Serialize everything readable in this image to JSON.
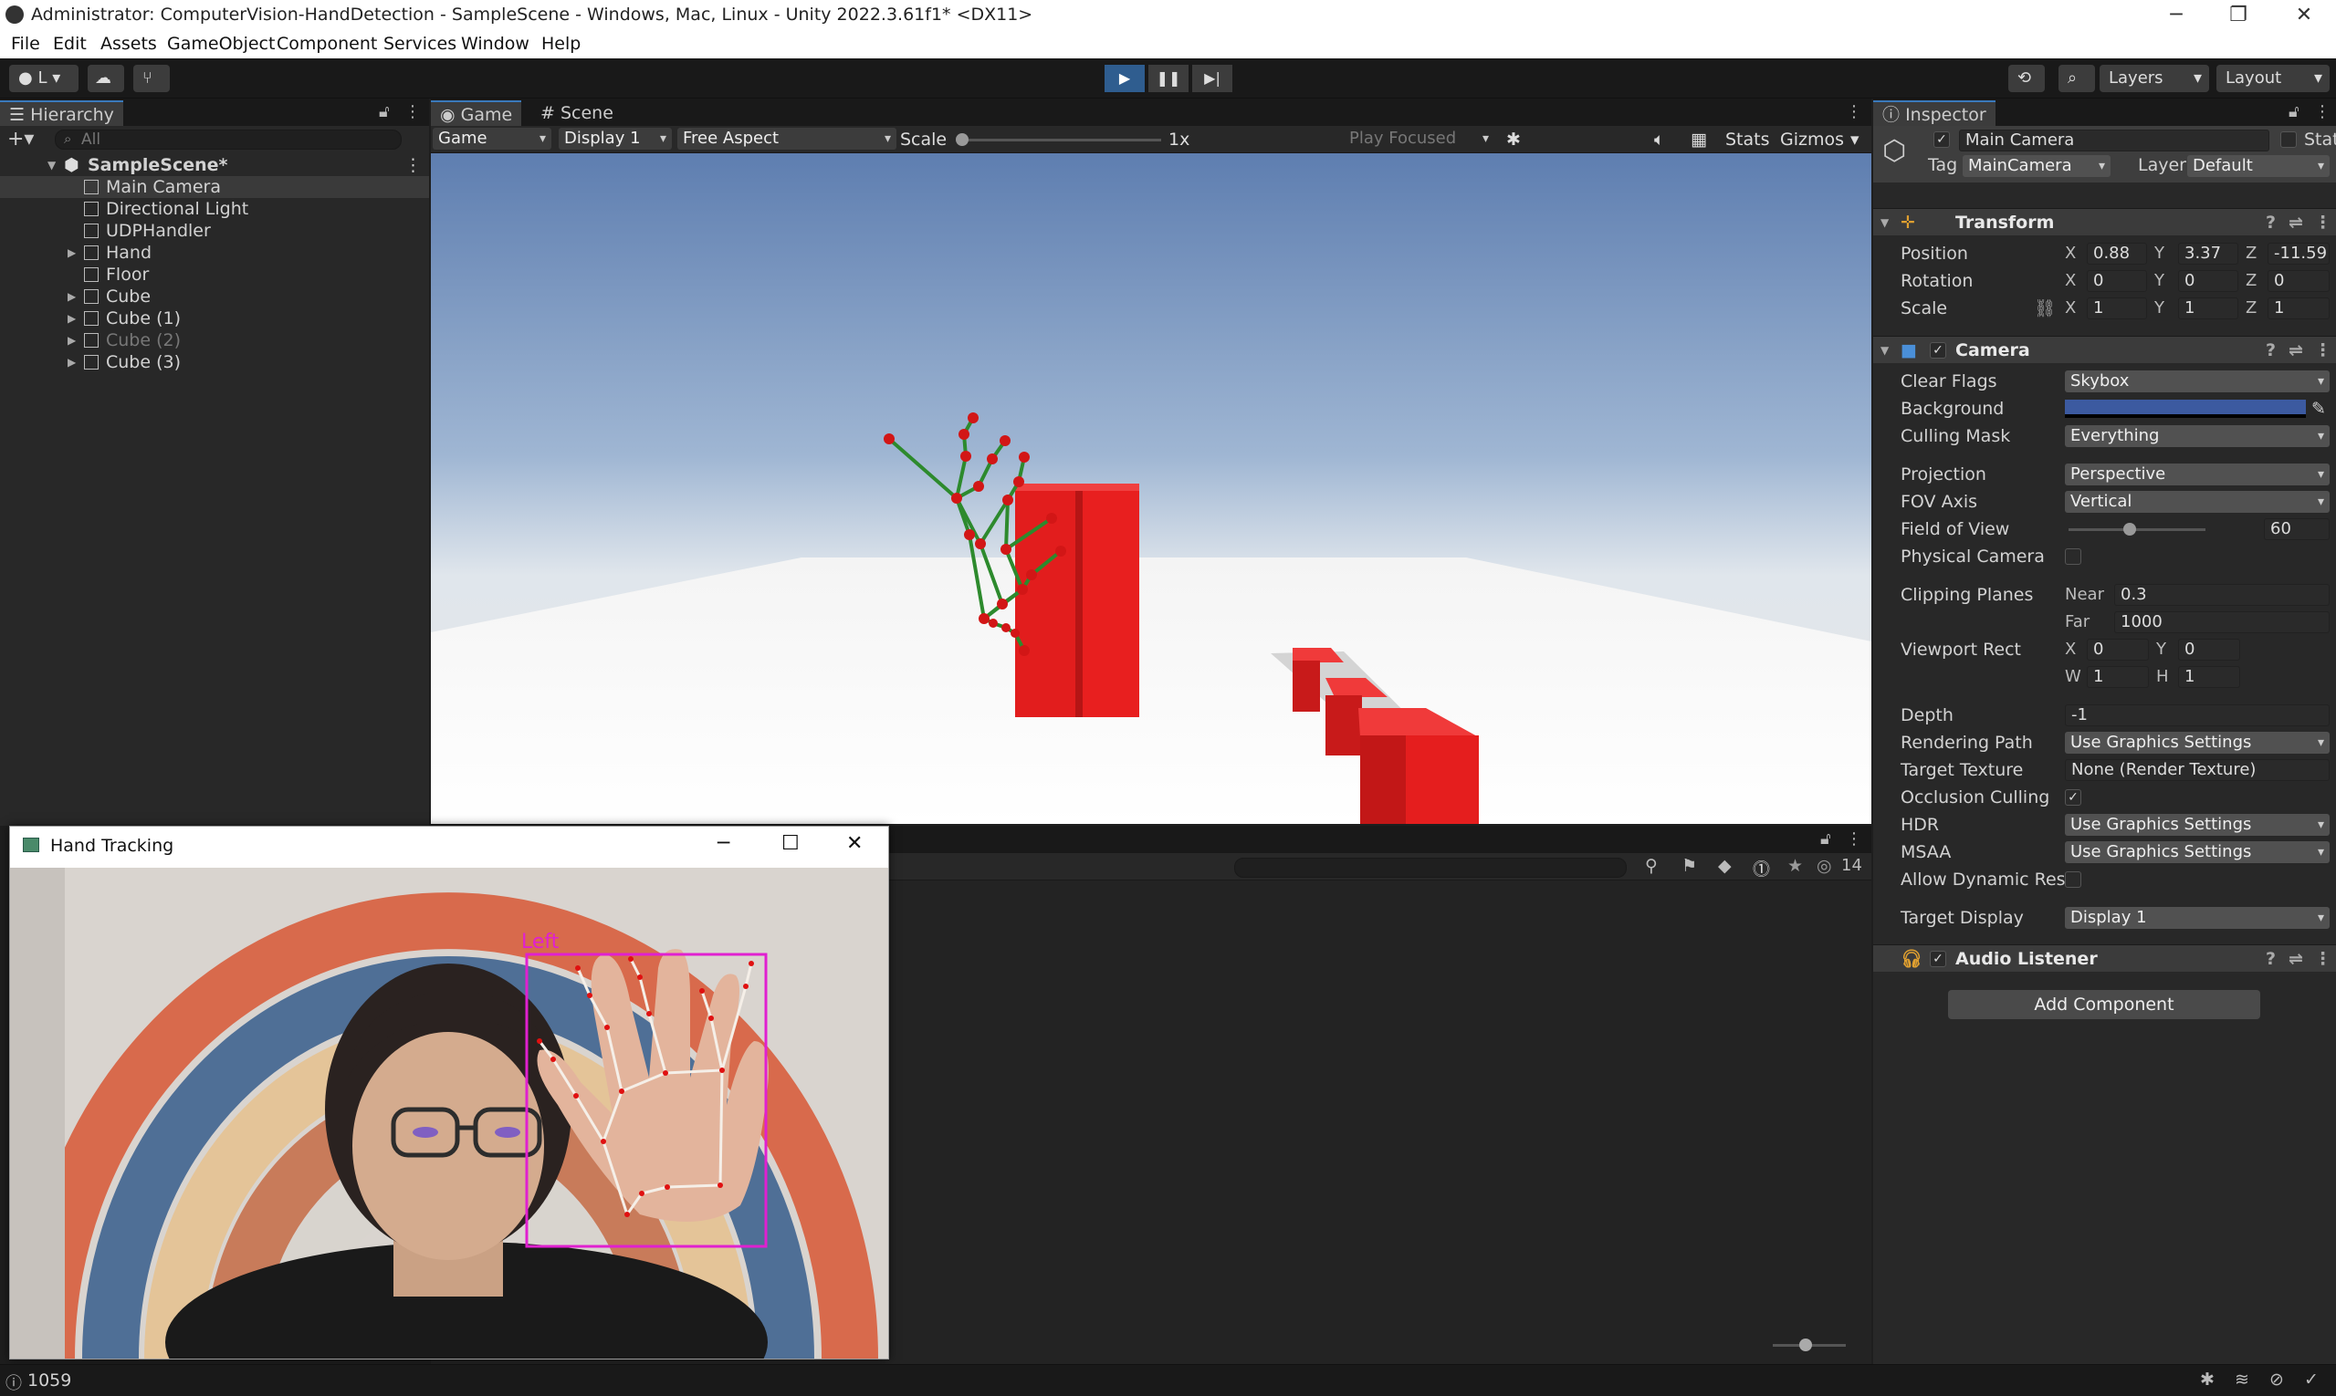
{
  "window": {
    "title": "Administrator: ComputerVision-HandDetection - SampleScene - Windows, Mac, Linux - Unity 2022.3.61f1* <DX11>"
  },
  "menu": [
    "File",
    "Edit",
    "Assets",
    "GameObject",
    "Component",
    "Services",
    "Window",
    "Help"
  ],
  "toolbar": {
    "account_label": "L",
    "layers_label": "Layers",
    "layout_label": "Layout"
  },
  "hierarchy": {
    "tab": "Hierarchy",
    "search_placeholder": "All",
    "scene": "SampleScene*",
    "items": [
      {
        "name": "Main Camera",
        "selected": true,
        "children": false,
        "dim": false
      },
      {
        "name": "Directional Light",
        "selected": false,
        "children": false,
        "dim": false
      },
      {
        "name": "UDPHandler",
        "selected": false,
        "children": false,
        "dim": false
      },
      {
        "name": "Hand",
        "selected": false,
        "children": true,
        "dim": false
      },
      {
        "name": "Floor",
        "selected": false,
        "children": false,
        "dim": false
      },
      {
        "name": "Cube",
        "selected": false,
        "children": true,
        "dim": false
      },
      {
        "name": "Cube (1)",
        "selected": false,
        "children": true,
        "dim": false
      },
      {
        "name": "Cube (2)",
        "selected": false,
        "children": true,
        "dim": true
      },
      {
        "name": "Cube (3)",
        "selected": false,
        "children": true,
        "dim": false
      }
    ]
  },
  "game": {
    "tab_game": "Game",
    "tab_scene": "Scene",
    "display_mode": "Game",
    "display": "Display 1",
    "aspect": "Free Aspect",
    "scale_label": "Scale",
    "scale_value": "1x",
    "play_focused": "Play Focused",
    "stats": "Stats",
    "gizmos": "Gizmos"
  },
  "console": {
    "count": "14"
  },
  "inspector": {
    "tab": "Inspector",
    "object_name": "Main Camera",
    "static_label": "Static",
    "tag_label": "Tag",
    "tag_value": "MainCamera",
    "layer_label": "Layer",
    "layer_value": "Default",
    "transform": {
      "title": "Transform",
      "position_label": "Position",
      "rotation_label": "Rotation",
      "scale_label": "Scale",
      "position": {
        "x": "0.88",
        "y": "3.37",
        "z": "-11.59"
      },
      "rotation": {
        "x": "0",
        "y": "0",
        "z": "0"
      },
      "scale": {
        "x": "1",
        "y": "1",
        "z": "1"
      }
    },
    "camera": {
      "title": "Camera",
      "clear_flags_label": "Clear Flags",
      "clear_flags": "Skybox",
      "background_label": "Background",
      "background_color": "#3c5aa0",
      "culling_mask_label": "Culling Mask",
      "culling_mask": "Everything",
      "projection_label": "Projection",
      "projection": "Perspective",
      "fov_axis_label": "FOV Axis",
      "fov_axis": "Vertical",
      "fov_label": "Field of View",
      "fov": "60",
      "physical_label": "Physical Camera",
      "clipping_label": "Clipping Planes",
      "near_label": "Near",
      "near": "0.3",
      "far_label": "Far",
      "far": "1000",
      "viewport_label": "Viewport Rect",
      "vp": {
        "x": "0",
        "y": "0",
        "w": "1",
        "h": "1"
      },
      "depth_label": "Depth",
      "depth": "-1",
      "rendering_path_label": "Rendering Path",
      "rendering_path": "Use Graphics Settings",
      "target_texture_label": "Target Texture",
      "target_texture": "None (Render Texture)",
      "occlusion_label": "Occlusion Culling",
      "hdr_label": "HDR",
      "hdr": "Use Graphics Settings",
      "msaa_label": "MSAA",
      "msaa": "Use Graphics Settings",
      "dynres_label": "Allow Dynamic Reso",
      "target_display_label": "Target Display",
      "target_display": "Display 1"
    },
    "audio_listener": "Audio Listener",
    "add_component": "Add Component"
  },
  "hand_tracking": {
    "title": "Hand Tracking",
    "hand_label": "Left"
  },
  "status": {
    "text": "1059"
  }
}
